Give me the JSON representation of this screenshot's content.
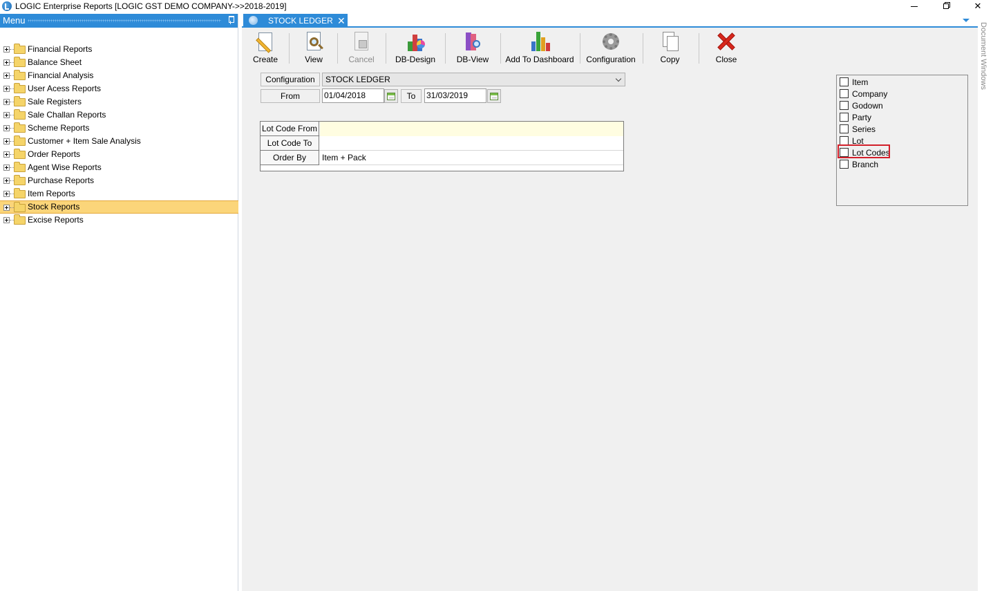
{
  "window": {
    "title": "LOGIC Enterprise Reports  [LOGIC GST DEMO COMPANY->>2018-2019]"
  },
  "menu": {
    "header": "Menu",
    "items": [
      {
        "label": "Financial Reports"
      },
      {
        "label": "Balance Sheet"
      },
      {
        "label": "Financial Analysis"
      },
      {
        "label": "User Acess Reports"
      },
      {
        "label": "Sale Registers"
      },
      {
        "label": "Sale Challan Reports"
      },
      {
        "label": "Scheme Reports"
      },
      {
        "label": "Customer + Item Sale Analysis"
      },
      {
        "label": "Order Reports"
      },
      {
        "label": "Agent Wise Reports"
      },
      {
        "label": "Purchase Reports"
      },
      {
        "label": "Item Reports"
      },
      {
        "label": "Stock Reports",
        "selected": true
      },
      {
        "label": "Excise Reports"
      }
    ]
  },
  "tab": {
    "label": "STOCK LEDGER",
    "close": "✕"
  },
  "toolbar": {
    "create": "Create",
    "view": "View",
    "cancel": "Cancel",
    "db_design": "DB-Design",
    "db_view": "DB-View",
    "add_to_dashboard": "Add To Dashboard",
    "configuration": "Configuration",
    "copy": "Copy",
    "close": "Close"
  },
  "form": {
    "configuration_label": "Configuration",
    "configuration_value": "STOCK LEDGER",
    "from_label": "From",
    "from_value": "01/04/2018",
    "to_label": "To",
    "to_value": "31/03/2019"
  },
  "grid": {
    "rows": [
      {
        "caption": "Lot Code From",
        "value": ""
      },
      {
        "caption": "Lot Code To",
        "value": ""
      },
      {
        "caption": "Order By",
        "value": "Item + Pack"
      }
    ]
  },
  "options": {
    "items": [
      {
        "label": "Item",
        "checked": false
      },
      {
        "label": "Company",
        "checked": false
      },
      {
        "label": "Godown",
        "checked": false
      },
      {
        "label": "Party",
        "checked": false
      },
      {
        "label": "Series",
        "checked": false
      },
      {
        "label": "Lot",
        "checked": false
      },
      {
        "label": "Lot Codes",
        "checked": false
      },
      {
        "label": "Branch",
        "checked": false
      }
    ],
    "highlighted": "Lot Codes",
    "highlight_color": "#d21f2a"
  },
  "side_panel": {
    "label": "Document Windows"
  },
  "colors": {
    "accent": "#2e8bd8",
    "selected_row": "#fbd57a",
    "close_icon": "#d8271c"
  }
}
